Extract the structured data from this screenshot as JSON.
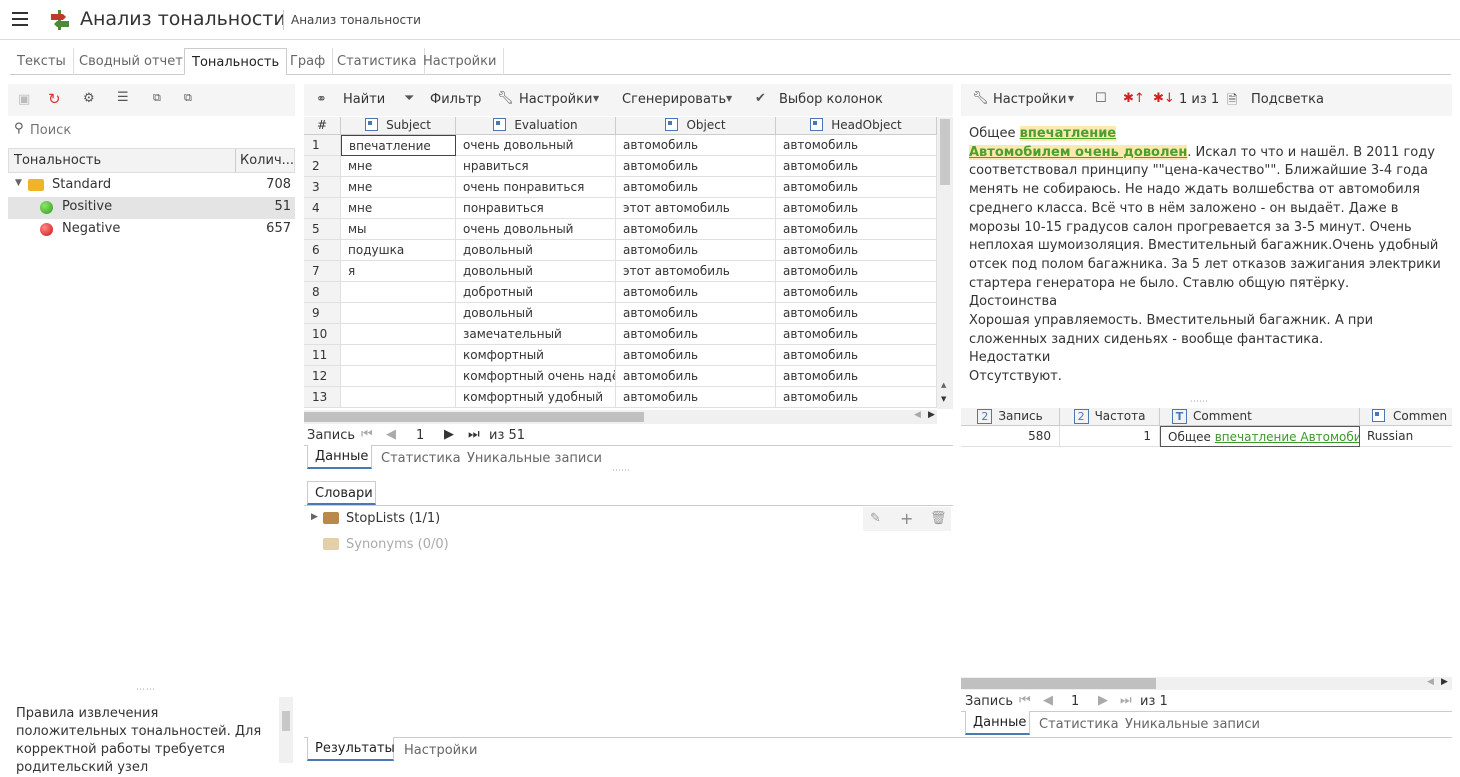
{
  "header": {
    "title": "Анализ тональности",
    "breadcrumb": "Анализ тональности"
  },
  "tabs": [
    "Тексты",
    "Сводный отчет",
    "Тональность",
    "Граф",
    "Статистика",
    "Настройки"
  ],
  "left": {
    "search_placeholder": "Поиск",
    "col_name": "Тональность",
    "col_count": "Колич...",
    "tree": [
      {
        "label": "Standard",
        "count": "708"
      },
      {
        "label": "Positive",
        "count": "51"
      },
      {
        "label": "Negative",
        "count": "657"
      }
    ],
    "description": "Правила извлечения положительных тональностей. Для корректной работы требуется родительский узел"
  },
  "toolbar": {
    "find": "Найти",
    "filter": "Фильтр",
    "settings": "Настройки",
    "generate": "Сгенерировать",
    "columns": "Выбор колонок"
  },
  "grid": {
    "headers": [
      "#",
      "Subject",
      "Evaluation",
      "Object",
      "HeadObject"
    ],
    "rows": [
      [
        "1",
        "впечатление",
        "очень довольный",
        "автомобиль",
        "автомобиль"
      ],
      [
        "2",
        "мне",
        "нравиться",
        "автомобиль",
        "автомобиль"
      ],
      [
        "3",
        "мне",
        "очень понравиться",
        "автомобиль",
        "автомобиль"
      ],
      [
        "4",
        "мне",
        "понравиться",
        "этот автомобиль",
        "автомобиль"
      ],
      [
        "5",
        "мы",
        "очень довольный",
        "автомобиль",
        "автомобиль"
      ],
      [
        "6",
        "подушка",
        "довольный",
        "автомобиль",
        "автомобиль"
      ],
      [
        "7",
        "я",
        "довольный",
        "этот автомобиль",
        "автомобиль"
      ],
      [
        "8",
        "",
        "добротный",
        "автомобиль",
        "автомобиль"
      ],
      [
        "9",
        "",
        "довольный",
        "автомобиль",
        "автомобиль"
      ],
      [
        "10",
        "",
        "замечательный",
        "автомобиль",
        "автомобиль"
      ],
      [
        "11",
        "",
        "комфортный",
        "автомобиль",
        "автомобиль"
      ],
      [
        "12",
        "",
        "комфортный очень надёжный",
        "автомобиль",
        "автомобиль"
      ],
      [
        "13",
        "",
        "комфортный удобный",
        "автомобиль",
        "автомобиль"
      ]
    ]
  },
  "pager": {
    "label": "Запись",
    "page": "1",
    "total": "из 51"
  },
  "mid_tabs": [
    "Данные",
    "Статистика",
    "Уникальные записи"
  ],
  "dict": {
    "tab": "Словари",
    "items": [
      {
        "label": "StopLists (1/1)"
      },
      {
        "label": "Synonyms (0/0)"
      }
    ]
  },
  "bottom_tabs": [
    "Результаты",
    "Настройки"
  ],
  "right": {
    "settings": "Настройки",
    "count": "1 из 1",
    "highlight": "Подсветка",
    "text_parts": {
      "p1": "Общее ",
      "hl1": "впечатление",
      "hl2": "Автомобилем очень доволен",
      "p2": ". Искал то что и нашёл. В 2011 году соответствовал принципу \"\"цена-качество\"\". Ближайшие 3-4 года менять не собираюсь. Не надо ждать волшебства от автомобиля среднего класса. Всё что в нём заложено - он выдаёт. Даже в морозы 10-15 градусов салон прогревается за 3-5 минут. Очень неплохая шумоизоляция. Вместительный багажник.Очень удобный отсек под полом багажника. За 5 лет отказов зажигания электрики стартера генератора не было. Ставлю общую пятёрку.",
      "p3": "Достоинства",
      "p4": "Хорошая управляемость. Вместительный багажник. А при сложенных задних сиденьях - вообще фантастика.",
      "p5": "Недостатки",
      "p6": "Отсутствуют."
    },
    "table": {
      "headers": [
        "Запись",
        "Частота",
        "Comment",
        "Commen"
      ],
      "row": {
        "rec": "580",
        "freq": "1",
        "comment_plain": "Общее ",
        "comment_link": "впечатление Автомобилем",
        "lang": "Russian"
      }
    },
    "pager": {
      "label": "Запись",
      "page": "1",
      "total": "из 1"
    },
    "tabs": [
      "Данные",
      "Статистика",
      "Уникальные записи"
    ]
  }
}
